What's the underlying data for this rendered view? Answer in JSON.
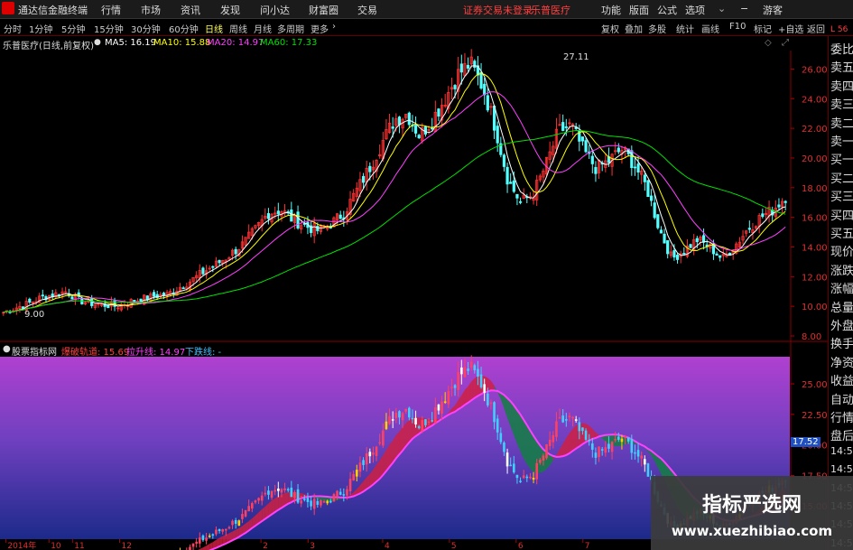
{
  "menu": {
    "app_title": "通达信金融终端",
    "items": [
      "行情",
      "市场",
      "资讯",
      "发现",
      "问小达",
      "财富圈",
      "交易"
    ],
    "status_text": "证券交易未登录",
    "stock_name": "乐普医疗",
    "right_items": [
      "功能",
      "版面",
      "公式",
      "选项"
    ],
    "user": "游客"
  },
  "periods": {
    "items": [
      "分时",
      "1分钟",
      "5分钟",
      "15分钟",
      "30分钟",
      "60分钟",
      "日线",
      "周线",
      "月线",
      "多周期",
      "更多"
    ],
    "active": "日线",
    "right_items": [
      "复权",
      "叠加",
      "多股",
      "统计",
      "画线",
      "F10",
      "标记",
      "+自选",
      "返回"
    ]
  },
  "chart_header": {
    "title": "乐普医疗(日线,前复权)",
    "ma5": "MA5: 16.19",
    "ma10": "MA10: 15.88",
    "ma20": "MA20: 14.97",
    "ma60": "MA60: 17.33",
    "colors": {
      "ma5": "#ffffff",
      "ma10": "#ffff00",
      "ma20": "#ff40ff",
      "ma60": "#00e000"
    }
  },
  "indicator_header": {
    "title": "股票指标网",
    "line1": "爆破轨道: 15.69",
    "line2": "拉升线: 14.97",
    "line3": "下跌线: -"
  },
  "right_panel": [
    "委比",
    "卖五",
    "卖四",
    "卖三",
    "卖二",
    "卖一",
    "买一",
    "买二",
    "买三",
    "买四",
    "买五",
    "现价",
    "涨跌",
    "涨幅",
    "总量",
    "外盘",
    "换手",
    "净资",
    "收益",
    "自动",
    "行情",
    "盘后",
    "14:50",
    "14:50",
    "14:50",
    "14:50",
    "14:50",
    "14:50"
  ],
  "price_annotations": {
    "high": "27.11",
    "low": "9.00",
    "current_tag": "17.52"
  },
  "axis": {
    "main_ticks": [
      "26.00",
      "24.00",
      "22.00",
      "20.00",
      "18.00",
      "16.00",
      "14.00",
      "12.00",
      "10.00",
      "8.00"
    ],
    "sub_ticks": [
      "25.00",
      "22.50",
      "20.00",
      "17.50",
      "15.00"
    ],
    "x_ticks": [
      "2014年",
      "10",
      "11",
      "12",
      "2",
      "3",
      "4",
      "5",
      "6",
      "7"
    ],
    "top_right_label": "L 56"
  },
  "watermark": {
    "title": "指标严选网",
    "url": "www.xuezhibiao.com"
  },
  "chart_data": [
    {
      "type": "candlestick",
      "title": "乐普医疗(日线,前复权)",
      "ylim": [
        8,
        27
      ],
      "approx_closes": [
        9.6,
        9.9,
        10.2,
        10.6,
        10.8,
        11.0,
        10.4,
        10.2,
        10.1,
        10.0,
        10.3,
        10.5,
        10.7,
        10.8,
        11.3,
        11.8,
        12.4,
        12.9,
        13.5,
        14.2,
        15.2,
        16.3,
        16.5,
        15.8,
        15.4,
        15.1,
        15.6,
        16.3,
        17.8,
        19.3,
        21.0,
        22.6,
        23.0,
        21.5,
        22.6,
        24.0,
        25.6,
        26.4,
        24.8,
        22.1,
        18.5,
        17.0,
        17.6,
        19.5,
        21.8,
        22.2,
        20.5,
        19.3,
        19.8,
        20.6,
        19.6,
        18.0,
        15.2,
        13.2,
        13.8,
        14.5,
        14.0,
        13.2,
        14.1,
        15.2,
        16.0,
        16.5,
        17.4
      ],
      "annotations": {
        "high": 27.11,
        "low": 9.0
      }
    },
    {
      "type": "line",
      "title": "股票指标网",
      "series": [
        {
          "name": "爆破轨道",
          "last": 15.69
        },
        {
          "name": "拉升线",
          "last": 14.97
        }
      ],
      "ylim": [
        12.5,
        27
      ]
    }
  ]
}
